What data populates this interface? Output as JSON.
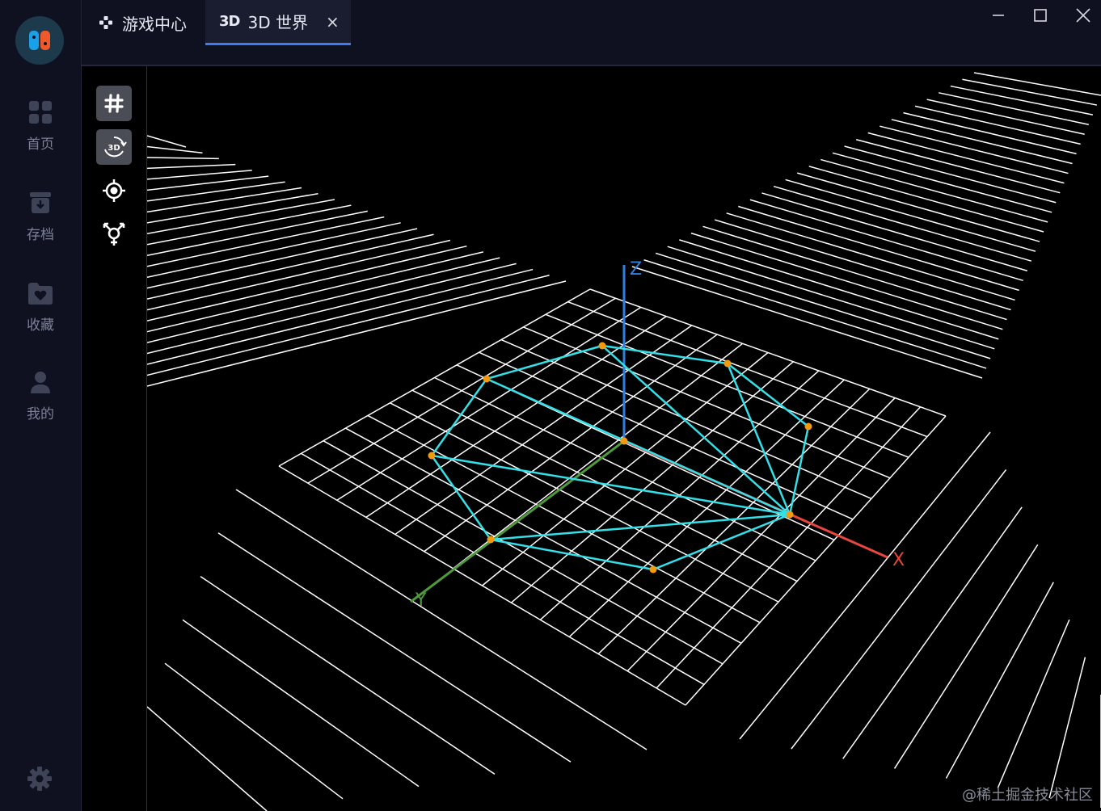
{
  "sidebar": {
    "logo_icon": "game-controller-logo-icon",
    "items": [
      {
        "label": "首页",
        "icon": "grid-icon"
      },
      {
        "label": "存档",
        "icon": "archive-icon"
      },
      {
        "label": "收藏",
        "icon": "heart-folder-icon"
      },
      {
        "label": "我的",
        "icon": "user-icon"
      }
    ],
    "settings_icon": "gear-icon"
  },
  "tabs": [
    {
      "label": "游戏中心",
      "icon": "gamepad-icon",
      "active": false
    },
    {
      "label": "3D 世界",
      "mark": "3D",
      "active": true,
      "close": "×"
    }
  ],
  "window_controls": [
    "minimize-icon",
    "maximize-icon",
    "close-icon"
  ],
  "tools": [
    {
      "name": "grid-toggle",
      "icon": "hash-icon",
      "active": true
    },
    {
      "name": "3d-rotate",
      "icon": "rotate-3d-icon",
      "mark": "3D",
      "active": true
    },
    {
      "name": "focus-target",
      "icon": "crosshair-icon",
      "active": false
    },
    {
      "name": "gender-symbol",
      "icon": "transgender-icon",
      "active": false
    }
  ],
  "scene": {
    "axes": {
      "x": "X",
      "y": "Y",
      "z": "Z"
    },
    "colors": {
      "x_axis": "#e8463f",
      "y_axis": "#4f9a3c",
      "z_axis": "#2f80e0",
      "mesh": "#34e0e8",
      "vertex": "#f39a12",
      "grid": "#ffffff",
      "background": "#000000"
    },
    "mesh_vertices": 9
  },
  "watermark": "@稀土掘金技术社区"
}
